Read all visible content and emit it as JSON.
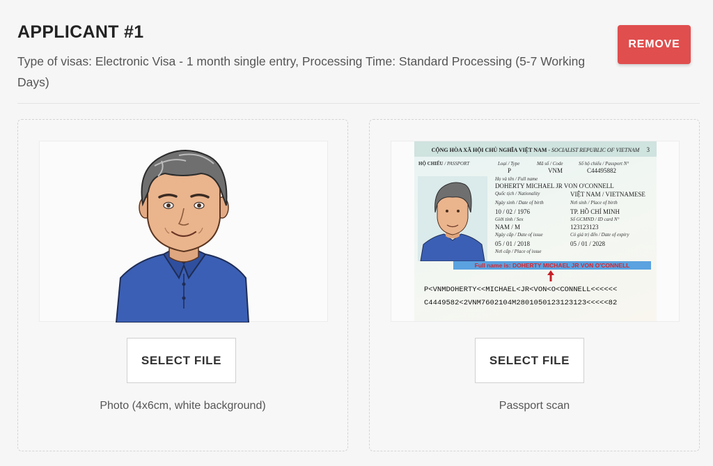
{
  "applicant": {
    "title": "APPLICANT #1",
    "subtitle": "Type of visas: Electronic Visa - 1 month single entry, Processing Time: Standard Processing (5-7 Working Days)",
    "remove_label": "REMOVE"
  },
  "uploads": [
    {
      "button_label": "SELECT FILE",
      "caption": "Photo (4x6cm, white background)"
    },
    {
      "button_label": "SELECT FILE",
      "caption": "Passport scan"
    }
  ],
  "passport": {
    "header": "CỘNG HÒA XÃ HỘI CHỦ NGHĨA VIỆT NAM",
    "header_en": " - SOCIALIST REPUBLIC OF VIETNAM",
    "page_number": "3",
    "labels": {
      "passport": "HỘ CHIẾU",
      "passport_en": " / PASSPORT",
      "type": "Loại / Type",
      "code": "Mã số / Code",
      "number": "Số hộ chiếu / Passport N°",
      "full_name": "Họ và tên / Full name",
      "nationality": "Quốc tịch / Nationality",
      "dob": "Ngày sinh / Date of birth",
      "pob": "Nơi sinh / Place of birth",
      "sex": "Giới tính / Sex",
      "id_card": "Số GCMND / ID card N°",
      "date_issue": "Ngày cấp / Date of issue",
      "date_expiry": "Có giá trị đến / Date of expiry",
      "place_issue": "Nơi cấp / Place of issue"
    },
    "values": {
      "type": "P",
      "code": "VNM",
      "number": "C44495882",
      "full_name": "DOHERTY MICHAEL JR VON O'CONNELL",
      "nationality": "VIỆT NAM / VIETNAMESE",
      "dob": "10 / 02 / 1976",
      "pob": "TP. HỒ CHÍ MINH",
      "sex": "NAM / M",
      "id_card": "123123123",
      "date_issue": "05 / 01 / 2018",
      "date_expiry": "05 / 01 / 2028"
    },
    "note": "Full name is: DOHERTY MICHAEL JR VON O'CONNELL",
    "mrz_line1": "P<VNMDOHERTY<<MICHAEL<JR<VON<O<CONNELL<<<<<<",
    "mrz_line2": "C4449582<2VNM7602104M2801050123123123<<<<<82"
  },
  "colors": {
    "remove": "#e04e4e",
    "highlight": "#5aa2e0",
    "note_text": "#d7262e",
    "shirt": "#3b5fb4"
  }
}
